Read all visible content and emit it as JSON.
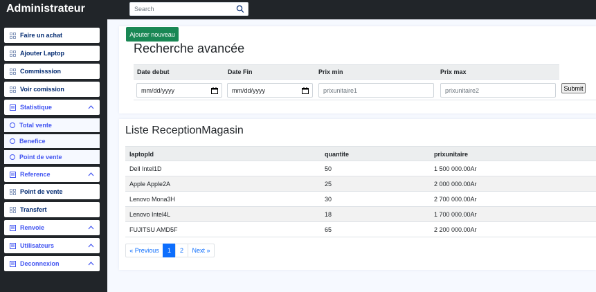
{
  "app": {
    "title": "Administrateur"
  },
  "search": {
    "placeholder": "Search"
  },
  "sidebar": {
    "items": [
      {
        "label": "Faire un achat"
      },
      {
        "label": "Ajouter Laptop"
      },
      {
        "label": "Commisssion"
      },
      {
        "label": "Voir comission"
      },
      {
        "label": "Statistique"
      },
      {
        "label": "Total vente"
      },
      {
        "label": "Benefice"
      },
      {
        "label": "Point de vente"
      },
      {
        "label": "Reference"
      },
      {
        "label": "Point de vente"
      },
      {
        "label": "Transfert"
      },
      {
        "label": "Renvoie"
      },
      {
        "label": "Utilisateurs"
      },
      {
        "label": "Deconnexion"
      }
    ]
  },
  "actions": {
    "add_new": "Ajouter nouveau"
  },
  "advanced_search": {
    "title": "Recherche avancée",
    "fields": [
      {
        "label": "Date debut",
        "value": "mm/dd/yyyy"
      },
      {
        "label": "Date Fin",
        "value": "mm/dd/yyyy"
      },
      {
        "label": "Prix min",
        "placeholder": "prixunitaire1"
      },
      {
        "label": "Prix max",
        "placeholder": "prixunitaire2"
      }
    ],
    "submit_label": "Submit"
  },
  "list": {
    "title": "Liste ReceptionMagasin",
    "columns": [
      "laptopId",
      "quantite",
      "prixunitaire"
    ],
    "rows": [
      [
        "Dell Intel1D",
        "50",
        "1 500 000.00Ar"
      ],
      [
        "Apple Apple2A",
        "25",
        "2 000 000.00Ar"
      ],
      [
        "Lenovo Mona3H",
        "30",
        "2 700 000.00Ar"
      ],
      [
        "Lenovo Intel4L",
        "18",
        "1 700 000.00Ar"
      ],
      [
        "FUJITSU AMD5F",
        "65",
        "2 200 000.00Ar"
      ]
    ]
  },
  "pagination": {
    "previous": "« Previous",
    "pages": [
      "1",
      "2"
    ],
    "active_page": "1",
    "next": "Next »"
  },
  "colors": {
    "topbar": "#212529",
    "accent": "#4154f1",
    "nav_text": "#012970",
    "success": "#198754",
    "primary": "#0d6efd"
  }
}
